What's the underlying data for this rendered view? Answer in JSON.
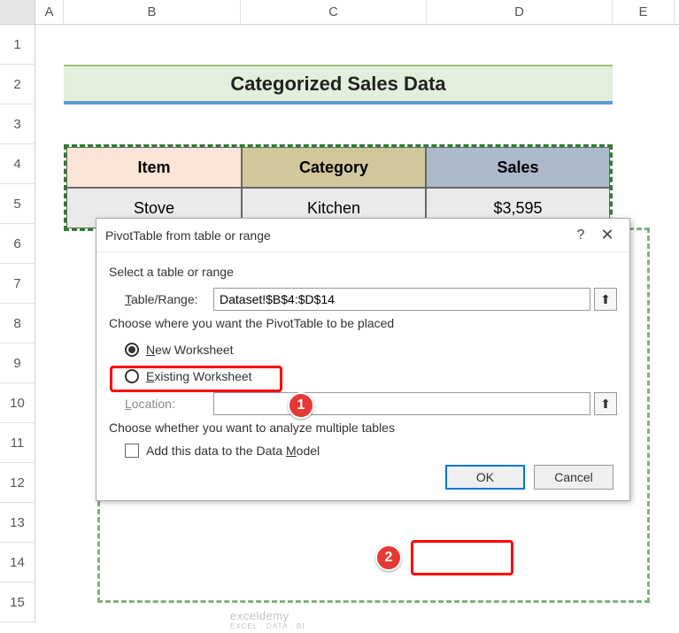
{
  "columns": {
    "A": "A",
    "B": "B",
    "C": "C",
    "D": "D",
    "E": "E"
  },
  "rows": [
    "1",
    "2",
    "3",
    "4",
    "5",
    "6",
    "7",
    "8",
    "9",
    "10",
    "11",
    "12",
    "13",
    "14",
    "15"
  ],
  "title": "Categorized Sales Data",
  "table": {
    "headers": {
      "item": "Item",
      "category": "Category",
      "sales": "Sales"
    },
    "row1": {
      "item": "Stove",
      "category": "Kitchen",
      "sales": "$3,595"
    }
  },
  "dialog": {
    "title": "PivotTable from table or range",
    "help": "?",
    "close": "✕",
    "section1": "Select a table or range",
    "tableRangeLabel": "Table/Range:",
    "tableRangeValue": "Dataset!$B$4:$D$14",
    "section2": "Choose where you want the PivotTable to be placed",
    "newWorksheet": "New Worksheet",
    "existingWorksheet": "Existing Worksheet",
    "locationLabel": "Location:",
    "locationValue": "",
    "section3": "Choose whether you want to analyze multiple tables",
    "addDataModel": "Add this data to the Data Model",
    "ok": "OK",
    "cancel": "Cancel",
    "refIcon": "⬆"
  },
  "badges": {
    "one": "1",
    "two": "2"
  },
  "watermark": {
    "main": "exceldemy",
    "sub": "EXCEL · DATA · BI"
  }
}
